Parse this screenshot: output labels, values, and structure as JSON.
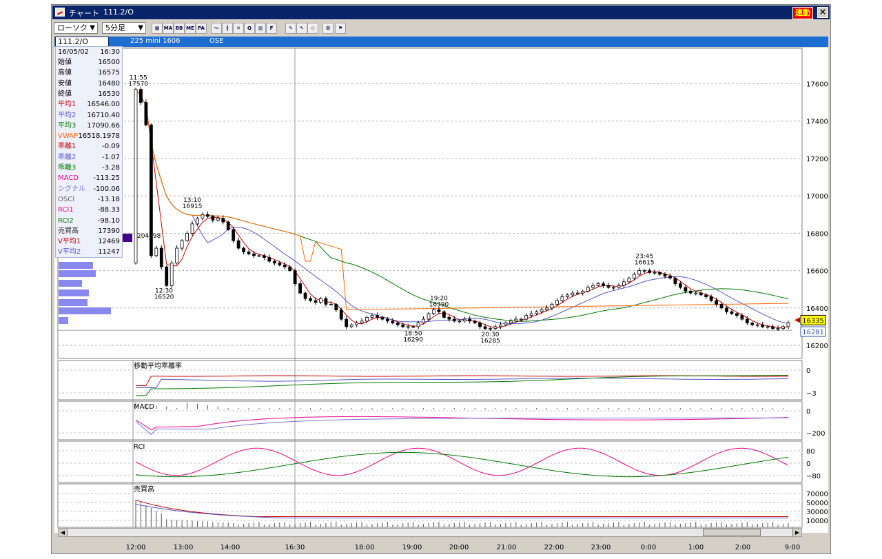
{
  "window": {
    "title": "チャート",
    "symbol_title": "111.2/O",
    "link_button": "連動",
    "close_label": "×"
  },
  "toolbar": {
    "chart_type": "ローソク",
    "interval": "5分足",
    "buttons": [
      {
        "name": "indicator-settings-icon",
        "text": "▦"
      },
      {
        "name": "ma-button",
        "text": "MA"
      },
      {
        "name": "bb-button",
        "text": "BB"
      },
      {
        "name": "me-button",
        "text": "ME"
      },
      {
        "name": "pa-button",
        "text": "PA"
      },
      {
        "name": "line-chart-icon",
        "text": "〜"
      },
      {
        "name": "candle-icon",
        "text": "╫"
      },
      {
        "name": "trend-icon",
        "text": "✕"
      },
      {
        "name": "zoom-icon",
        "text": "Q"
      },
      {
        "name": "bar-icon",
        "text": "▥"
      },
      {
        "name": "fibonacci-icon",
        "text": "F"
      },
      {
        "name": "pen-icon",
        "text": "✎"
      },
      {
        "name": "cursor-icon",
        "text": "↖"
      },
      {
        "name": "eraser-icon",
        "text": "◇"
      },
      {
        "name": "palette-icon",
        "text": "❂"
      },
      {
        "name": "flag-icon",
        "text": "⚑"
      }
    ]
  },
  "infobar": {
    "symbol": "111.2/O",
    "contract": "225 mini 1606",
    "exchange": "OSE"
  },
  "data_window": {
    "date": "16/05/02",
    "time": "16:30",
    "rows": [
      {
        "label": "始値",
        "value": "16500",
        "color": "#000000"
      },
      {
        "label": "高値",
        "value": "16575",
        "color": "#000000"
      },
      {
        "label": "安値",
        "value": "16480",
        "color": "#000000"
      },
      {
        "label": "終値",
        "value": "16530",
        "color": "#000000"
      },
      {
        "label": "平均1",
        "value": "16546.00",
        "color": "#cc0000"
      },
      {
        "label": "平均2",
        "value": "16710.40",
        "color": "#5555cc"
      },
      {
        "label": "平均3",
        "value": "17090.66",
        "color": "#007700"
      },
      {
        "label": "VWAP",
        "value": "16518.1978",
        "color": "#ff6600"
      },
      {
        "label": "乖離1",
        "value": "-0.09",
        "color": "#cc0000"
      },
      {
        "label": "乖離2",
        "value": "-1.07",
        "color": "#5555cc"
      },
      {
        "label": "乖離3",
        "value": "-3.28",
        "color": "#007700"
      },
      {
        "label": "MACD",
        "value": "-113.25",
        "color": "#ee0088"
      },
      {
        "label": "シグナル",
        "value": "-100.06",
        "color": "#7777dd"
      },
      {
        "label": "OSCI",
        "value": "-13.18",
        "color": "#666666"
      },
      {
        "label": "RCI1",
        "value": "-88.33",
        "color": "#ee0088"
      },
      {
        "label": "RCI2",
        "value": "-98.10",
        "color": "#007700"
      },
      {
        "label": "売買高",
        "value": "17390",
        "color": "#333333"
      },
      {
        "label": "V平均1",
        "value": "12469",
        "color": "#cc0000"
      },
      {
        "label": "V平均2",
        "value": "11247",
        "color": "#5555cc"
      }
    ]
  },
  "chart_data": [
    {
      "type": "candlestick",
      "title": "",
      "y_ticks": [
        16200,
        16400,
        16600,
        16800,
        17000,
        17200,
        17400,
        17600
      ],
      "ylim": [
        16130,
        17790
      ],
      "x_ticks": [
        "12:00",
        "13:00",
        "14:00",
        "16:30",
        "18:00",
        "19:00",
        "20:00",
        "21:00",
        "22:00",
        "23:00",
        "0:00",
        "1:00",
        "2:00",
        "9:00"
      ],
      "last_price": "16335",
      "last_price_color": "#ffff00",
      "other_price": "16281",
      "volume_profile_label": "204498",
      "annotations": [
        {
          "label": "11:55",
          "value": "17570",
          "xi": 0.5,
          "y": 17570,
          "pos": "above"
        },
        {
          "label": "12:30",
          "value": "16520",
          "xi": 5.5,
          "y": 16520,
          "pos": "below"
        },
        {
          "label": "13:10",
          "value": "16915",
          "xi": 11,
          "y": 16915,
          "pos": "above"
        },
        {
          "label": "19:20",
          "value": "16390",
          "xi": 59,
          "y": 16390,
          "pos": "above"
        },
        {
          "label": "18:50",
          "value": "16290",
          "xi": 54,
          "y": 16290,
          "pos": "below"
        },
        {
          "label": "20:30",
          "value": "16285",
          "xi": 69,
          "y": 16285,
          "pos": "below"
        },
        {
          "label": "23:45",
          "value": "16615",
          "xi": 99,
          "y": 16615,
          "pos": "above"
        }
      ],
      "closes": [
        17570,
        17500,
        17380,
        16680,
        16720,
        16620,
        16520,
        16640,
        16720,
        16760,
        16800,
        16850,
        16880,
        16900,
        16890,
        16870,
        16880,
        16860,
        16820,
        16760,
        16720,
        16700,
        16690,
        16680,
        16680,
        16670,
        16650,
        16640,
        16630,
        16620,
        16600,
        16530,
        16480,
        16450,
        16440,
        16430,
        16450,
        16420,
        16420,
        16390,
        16340,
        16300,
        16310,
        16320,
        16330,
        16350,
        16360,
        16350,
        16340,
        16330,
        16320,
        16310,
        16300,
        16300,
        16300,
        16320,
        16340,
        16370,
        16390,
        16380,
        16350,
        16340,
        16330,
        16330,
        16340,
        16330,
        16320,
        16300,
        16290,
        16290,
        16300,
        16310,
        16320,
        16330,
        16340,
        16340,
        16360,
        16370,
        16380,
        16390,
        16400,
        16420,
        16440,
        16460,
        16470,
        16480,
        16480,
        16490,
        16510,
        16520,
        16530,
        16520,
        16510,
        16510,
        16520,
        16540,
        16560,
        16580,
        16600,
        16600,
        16590,
        16590,
        16580,
        16570,
        16560,
        16530,
        16510,
        16490,
        16480,
        16480,
        16470,
        16460,
        16440,
        16420,
        16400,
        16380,
        16370,
        16360,
        16340,
        16320,
        16310,
        16310,
        16300,
        16300,
        16290,
        16290,
        16300,
        16320
      ],
      "series": [
        {
          "name": "平均1",
          "color": "#cc0000"
        },
        {
          "name": "平均2",
          "color": "#5555cc"
        },
        {
          "name": "平均3",
          "color": "#007700"
        },
        {
          "name": "VWAP",
          "color": "#ff6600"
        }
      ]
    },
    {
      "type": "line",
      "title": "移動平均乖離率",
      "y_ticks": [
        "0",
        "−3"
      ]
    },
    {
      "type": "line",
      "title": "MACD",
      "y_ticks": [
        "0",
        "−200"
      ]
    },
    {
      "type": "line",
      "title": "RCI",
      "y_ticks": [
        "80",
        "0",
        "−80"
      ]
    },
    {
      "type": "bar",
      "title": "売買高",
      "y_ticks": [
        "70000",
        "50000",
        "30000",
        "10000"
      ]
    }
  ]
}
